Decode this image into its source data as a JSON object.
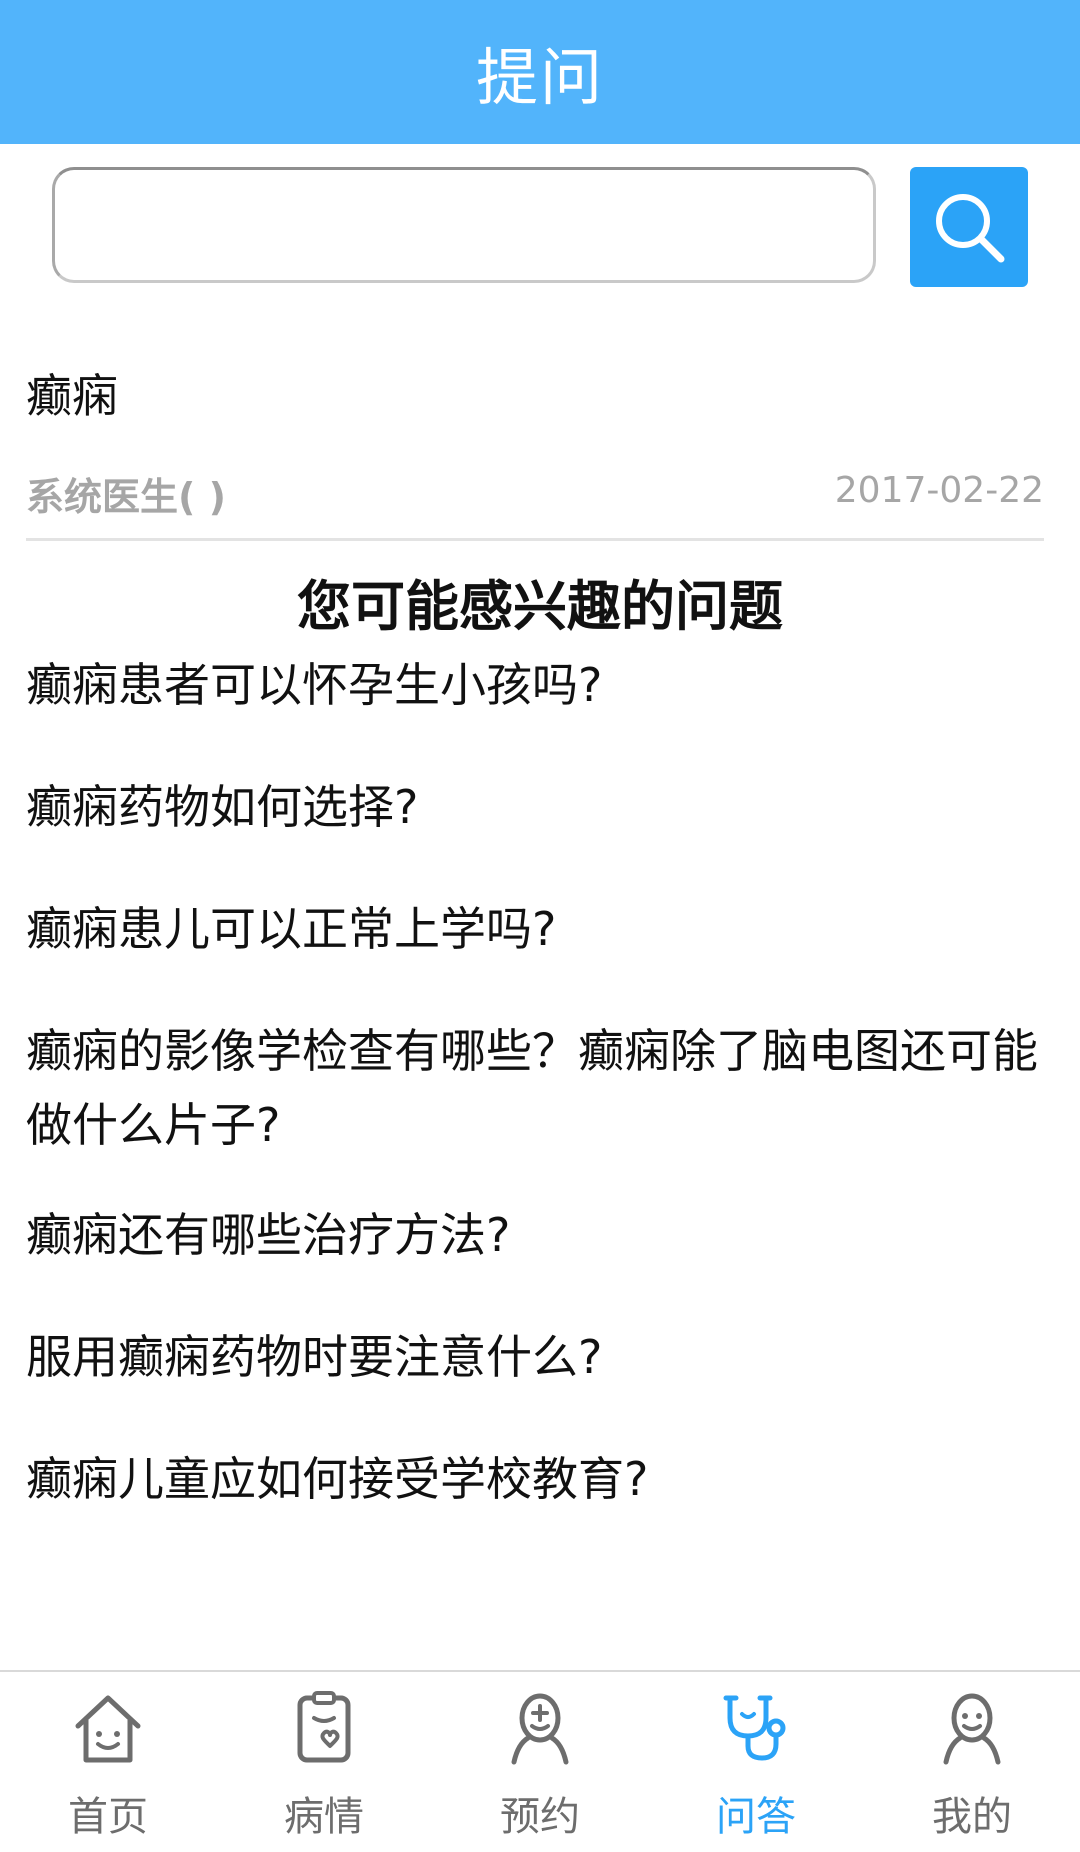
{
  "header": {
    "title": "提问"
  },
  "search": {
    "value": "",
    "placeholder": ""
  },
  "question": {
    "title": "癫痫",
    "author": "系统医生( )",
    "date": "2017-02-22"
  },
  "related": {
    "heading": "您可能感兴趣的问题",
    "items": [
      "癫痫患者可以怀孕生小孩吗?",
      "癫痫药物如何选择?",
      "癫痫患儿可以正常上学吗?",
      "癫痫的影像学检查有哪些？癫痫除了脑电图还可能做什么片子?",
      "癫痫还有哪些治疗方法?",
      "服用癫痫药物时要注意什么?",
      "癫痫儿童应如何接受学校教育?"
    ]
  },
  "nav": {
    "items": [
      {
        "label": "首页",
        "icon": "home-icon"
      },
      {
        "label": "病情",
        "icon": "clipboard-heart-icon"
      },
      {
        "label": "预约",
        "icon": "doctor-icon"
      },
      {
        "label": "问答",
        "icon": "stethoscope-icon",
        "active": true
      },
      {
        "label": "我的",
        "icon": "user-icon"
      }
    ]
  },
  "colors": {
    "header": "#52b4fb",
    "accent": "#2ba3f7",
    "muted": "#a6a6a6",
    "nav_inactive": "#6d6d6d"
  }
}
